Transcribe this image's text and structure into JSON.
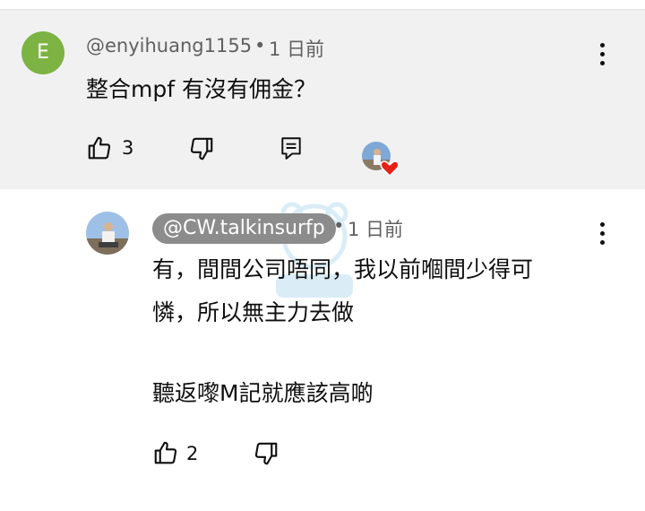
{
  "comment": {
    "avatar_letter": "E",
    "handle": "@enyihuang1155",
    "separator": "•",
    "time": "1 日前",
    "text": "整合mpf 有沒有佣金？",
    "likes": "3"
  },
  "reply": {
    "handle": "@CW.talkinsurfp",
    "separator": "•",
    "time": "1 日前",
    "text_line1": "有，間間公司唔同，我以前嗰間少得可",
    "text_line2": "憐，所以無主力去做",
    "text_line3": "聽返嚟M記就應該高啲",
    "likes": "2"
  },
  "icons": {
    "like": "thumbs-up-icon",
    "dislike": "thumbs-down-icon",
    "reply": "reply-icon",
    "more": "more-vert-icon",
    "heart": "heart-icon"
  },
  "colors": {
    "comment_bg": "#f1f1f1",
    "avatar_e": "#7cb342",
    "handle_pill": "#8c8c8c",
    "heart": "#e62117"
  }
}
